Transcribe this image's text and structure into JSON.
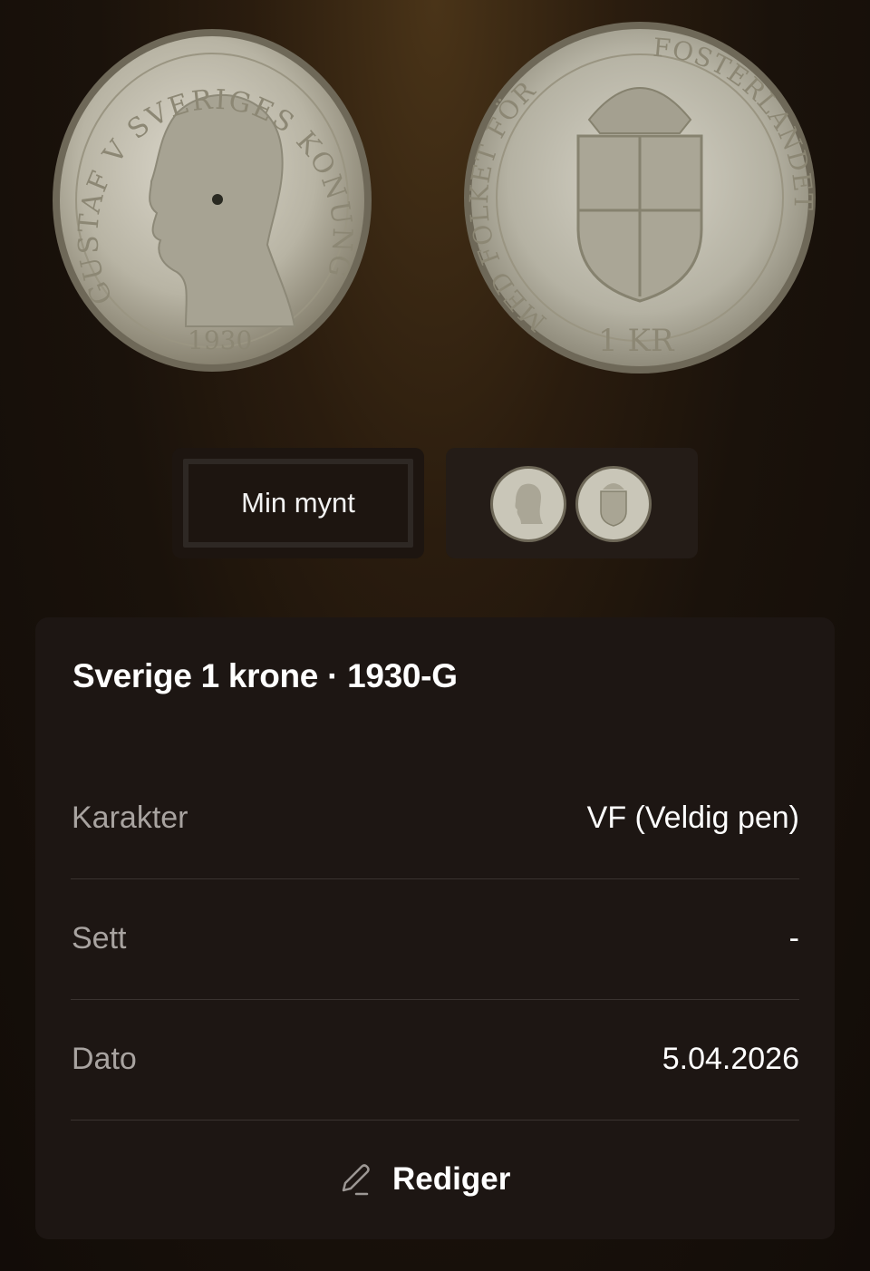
{
  "coin_images": {
    "obverse_legend": "GUSTAF V SVERIGES KONUNG",
    "obverse_year": "1930",
    "reverse_legend_left": "MED FOLKET FÖR",
    "reverse_legend_right": "FOSTERLANDET",
    "reverse_value": "1 KR"
  },
  "tabs": {
    "my_coin_label": "Min mynt"
  },
  "details": {
    "title": "Sverige 1 krone · 1930-G",
    "rows": [
      {
        "key": "Karakter",
        "value": "VF (Veldig pen)"
      },
      {
        "key": "Sett",
        "value": "-"
      },
      {
        "key": "Dato",
        "value": "5.04.2026"
      }
    ],
    "edit_label": "Rediger"
  },
  "colors": {
    "card_bg": "#1d1613",
    "divider": "#3a3330",
    "coin_silver": "#c8c4b6"
  },
  "icons": {
    "edit": "pencil-icon"
  }
}
